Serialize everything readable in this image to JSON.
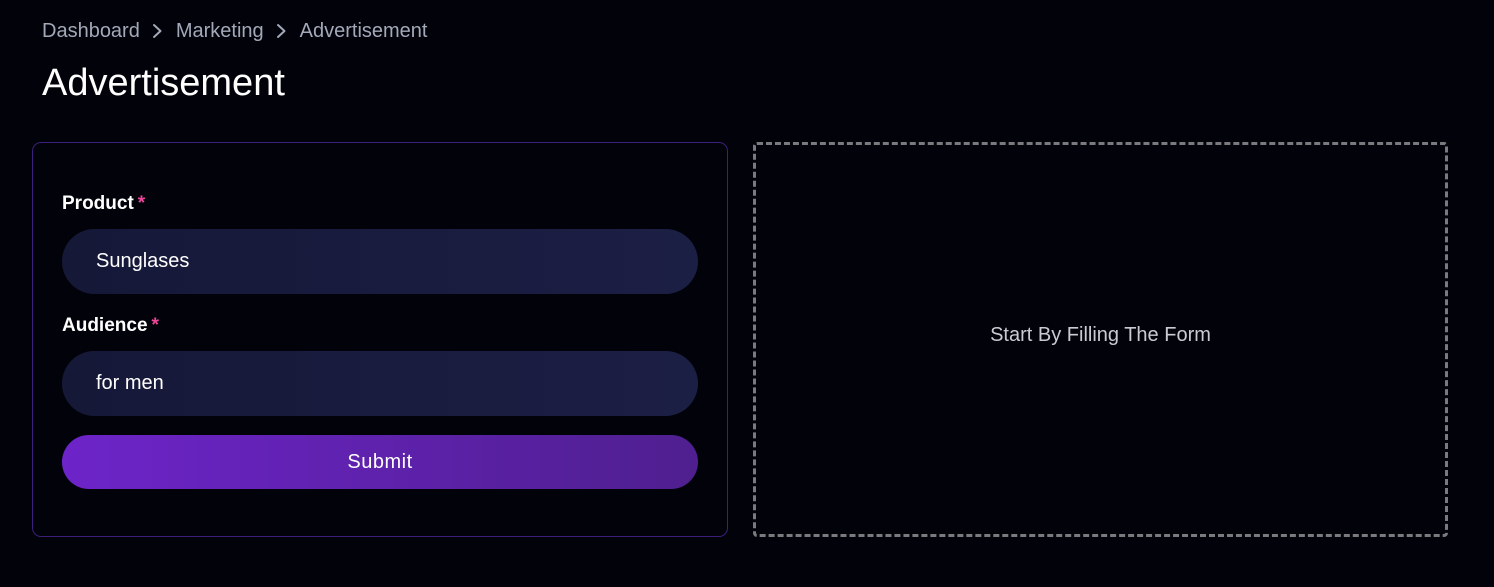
{
  "breadcrumb": {
    "items": [
      {
        "label": "Dashboard"
      },
      {
        "label": "Marketing"
      },
      {
        "label": "Advertisement"
      }
    ]
  },
  "page": {
    "title": "Advertisement"
  },
  "form": {
    "product": {
      "label": "Product",
      "required_mark": "*",
      "value": "Sunglases"
    },
    "audience": {
      "label": "Audience",
      "required_mark": "*",
      "value": "for men"
    },
    "submit_label": "Submit"
  },
  "output": {
    "placeholder": "Start By Filling The Form"
  },
  "colors": {
    "background": "#02030a",
    "accent": "#6d24c9",
    "required": "#ec4899",
    "card_border": "#3b1f7a",
    "input_bg": "#161838"
  },
  "icons": {
    "breadcrumb_separator": "chevron-right-icon"
  }
}
